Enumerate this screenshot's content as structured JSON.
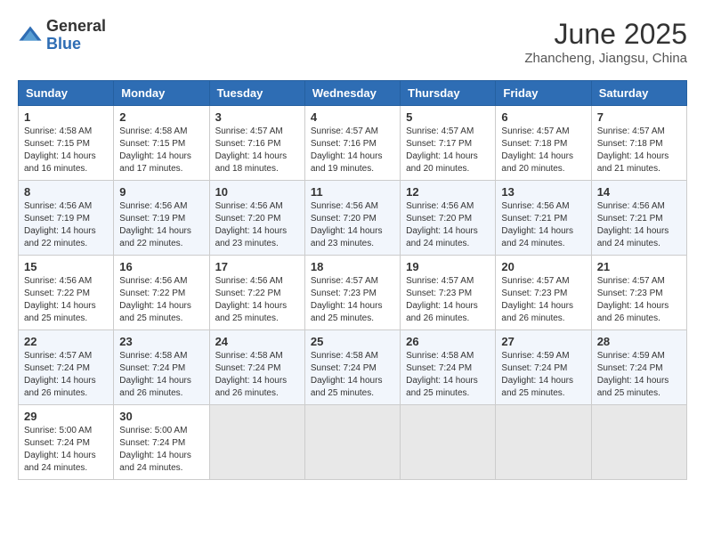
{
  "header": {
    "logo_general": "General",
    "logo_blue": "Blue",
    "month_title": "June 2025",
    "location": "Zhancheng, Jiangsu, China"
  },
  "weekdays": [
    "Sunday",
    "Monday",
    "Tuesday",
    "Wednesday",
    "Thursday",
    "Friday",
    "Saturday"
  ],
  "weeks": [
    [
      {
        "day": "1",
        "sunrise": "4:58 AM",
        "sunset": "7:15 PM",
        "daylight": "14 hours and 16 minutes."
      },
      {
        "day": "2",
        "sunrise": "4:58 AM",
        "sunset": "7:15 PM",
        "daylight": "14 hours and 17 minutes."
      },
      {
        "day": "3",
        "sunrise": "4:57 AM",
        "sunset": "7:16 PM",
        "daylight": "14 hours and 18 minutes."
      },
      {
        "day": "4",
        "sunrise": "4:57 AM",
        "sunset": "7:16 PM",
        "daylight": "14 hours and 19 minutes."
      },
      {
        "day": "5",
        "sunrise": "4:57 AM",
        "sunset": "7:17 PM",
        "daylight": "14 hours and 20 minutes."
      },
      {
        "day": "6",
        "sunrise": "4:57 AM",
        "sunset": "7:18 PM",
        "daylight": "14 hours and 20 minutes."
      },
      {
        "day": "7",
        "sunrise": "4:57 AM",
        "sunset": "7:18 PM",
        "daylight": "14 hours and 21 minutes."
      }
    ],
    [
      {
        "day": "8",
        "sunrise": "4:56 AM",
        "sunset": "7:19 PM",
        "daylight": "14 hours and 22 minutes."
      },
      {
        "day": "9",
        "sunrise": "4:56 AM",
        "sunset": "7:19 PM",
        "daylight": "14 hours and 22 minutes."
      },
      {
        "day": "10",
        "sunrise": "4:56 AM",
        "sunset": "7:20 PM",
        "daylight": "14 hours and 23 minutes."
      },
      {
        "day": "11",
        "sunrise": "4:56 AM",
        "sunset": "7:20 PM",
        "daylight": "14 hours and 23 minutes."
      },
      {
        "day": "12",
        "sunrise": "4:56 AM",
        "sunset": "7:20 PM",
        "daylight": "14 hours and 24 minutes."
      },
      {
        "day": "13",
        "sunrise": "4:56 AM",
        "sunset": "7:21 PM",
        "daylight": "14 hours and 24 minutes."
      },
      {
        "day": "14",
        "sunrise": "4:56 AM",
        "sunset": "7:21 PM",
        "daylight": "14 hours and 24 minutes."
      }
    ],
    [
      {
        "day": "15",
        "sunrise": "4:56 AM",
        "sunset": "7:22 PM",
        "daylight": "14 hours and 25 minutes."
      },
      {
        "day": "16",
        "sunrise": "4:56 AM",
        "sunset": "7:22 PM",
        "daylight": "14 hours and 25 minutes."
      },
      {
        "day": "17",
        "sunrise": "4:56 AM",
        "sunset": "7:22 PM",
        "daylight": "14 hours and 25 minutes."
      },
      {
        "day": "18",
        "sunrise": "4:57 AM",
        "sunset": "7:23 PM",
        "daylight": "14 hours and 25 minutes."
      },
      {
        "day": "19",
        "sunrise": "4:57 AM",
        "sunset": "7:23 PM",
        "daylight": "14 hours and 26 minutes."
      },
      {
        "day": "20",
        "sunrise": "4:57 AM",
        "sunset": "7:23 PM",
        "daylight": "14 hours and 26 minutes."
      },
      {
        "day": "21",
        "sunrise": "4:57 AM",
        "sunset": "7:23 PM",
        "daylight": "14 hours and 26 minutes."
      }
    ],
    [
      {
        "day": "22",
        "sunrise": "4:57 AM",
        "sunset": "7:24 PM",
        "daylight": "14 hours and 26 minutes."
      },
      {
        "day": "23",
        "sunrise": "4:58 AM",
        "sunset": "7:24 PM",
        "daylight": "14 hours and 26 minutes."
      },
      {
        "day": "24",
        "sunrise": "4:58 AM",
        "sunset": "7:24 PM",
        "daylight": "14 hours and 26 minutes."
      },
      {
        "day": "25",
        "sunrise": "4:58 AM",
        "sunset": "7:24 PM",
        "daylight": "14 hours and 25 minutes."
      },
      {
        "day": "26",
        "sunrise": "4:58 AM",
        "sunset": "7:24 PM",
        "daylight": "14 hours and 25 minutes."
      },
      {
        "day": "27",
        "sunrise": "4:59 AM",
        "sunset": "7:24 PM",
        "daylight": "14 hours and 25 minutes."
      },
      {
        "day": "28",
        "sunrise": "4:59 AM",
        "sunset": "7:24 PM",
        "daylight": "14 hours and 25 minutes."
      }
    ],
    [
      {
        "day": "29",
        "sunrise": "5:00 AM",
        "sunset": "7:24 PM",
        "daylight": "14 hours and 24 minutes."
      },
      {
        "day": "30",
        "sunrise": "5:00 AM",
        "sunset": "7:24 PM",
        "daylight": "14 hours and 24 minutes."
      },
      null,
      null,
      null,
      null,
      null
    ]
  ],
  "labels": {
    "sunrise": "Sunrise:",
    "sunset": "Sunset:",
    "daylight": "Daylight hours"
  }
}
